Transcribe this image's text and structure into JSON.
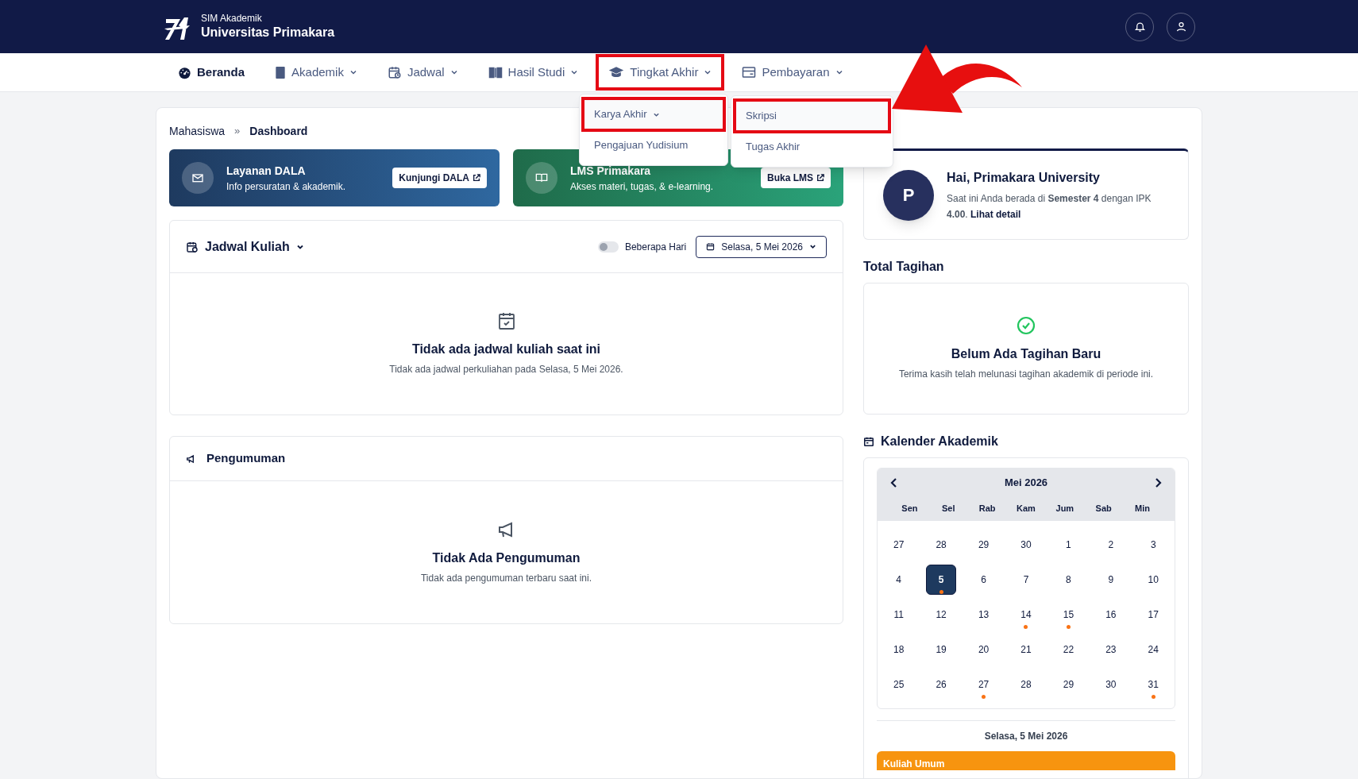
{
  "header": {
    "subtitle": "SIM Akademik",
    "title": "Universitas Primakara"
  },
  "nav": [
    {
      "label": "Beranda",
      "selected": true,
      "dropdown": false,
      "highlighted": false
    },
    {
      "label": "Akademik",
      "selected": false,
      "dropdown": true,
      "highlighted": false
    },
    {
      "label": "Jadwal",
      "selected": false,
      "dropdown": true,
      "highlighted": false
    },
    {
      "label": "Hasil Studi",
      "selected": false,
      "dropdown": true,
      "highlighted": false
    },
    {
      "label": "Tingkat Akhir",
      "selected": false,
      "dropdown": true,
      "highlighted": true
    },
    {
      "label": "Pembayaran",
      "selected": false,
      "dropdown": true,
      "highlighted": false
    }
  ],
  "menu": [
    {
      "label": "Karya Akhir",
      "submenu": true,
      "highlighted": true
    },
    {
      "label": "Pengajuan Yudisium",
      "submenu": false,
      "highlighted": false
    }
  ],
  "submenu": [
    {
      "label": "Skripsi",
      "highlighted": true
    },
    {
      "label": "Tugas Akhir",
      "highlighted": false
    }
  ],
  "breadcrumb": [
    "Mahasiswa",
    "Dashboard"
  ],
  "breadcrumb_separator": "»",
  "banners": [
    {
      "title": "Layanan DALA",
      "subtitle": "Info persuratan & akademik.",
      "button": "Kunjungi DALA"
    },
    {
      "title": "LMS Primakara",
      "subtitle": "Akses materi, tugas, & e-learning.",
      "button": "Buka LMS"
    }
  ],
  "schedule": {
    "title": "Jadwal Kuliah",
    "toggle": {
      "label": "Beberapa Hari",
      "on": false
    },
    "date": "Selasa, 5 Mei 2026",
    "empty_title": "Tidak ada jadwal kuliah saat ini",
    "empty_text": "Tidak ada jadwal perkuliahan pada Selasa, 5 Mei 2026."
  },
  "announcements": {
    "title": "Pengumuman",
    "empty_title": "Tidak Ada Pengumuman",
    "empty_text": "Tidak ada pengumuman terbaru saat ini."
  },
  "profile": {
    "initial": "P",
    "greeting": "Hai, Primakara University",
    "text": "Saat ini Anda berada di **Semester 4** dengan IPK **4.00**.",
    "link": "Lihat detail"
  },
  "billing": {
    "heading": "Total Tagihan",
    "title": "Belum Ada Tagihan Baru",
    "text": "Terima kasih telah melunasi tagihan akademik di periode ini."
  },
  "calendar": {
    "heading": "Kalender Akademik",
    "month": "Mei 2026",
    "weekdays": [
      "Sen",
      "Sel",
      "Rab",
      "Kam",
      "Jum",
      "Sab",
      "Min"
    ],
    "days": [
      {
        "day": "27",
        "selected": false,
        "event": false
      },
      {
        "day": "28",
        "selected": false,
        "event": false
      },
      {
        "day": "29",
        "selected": false,
        "event": false
      },
      {
        "day": "30",
        "selected": false,
        "event": false
      },
      {
        "day": "1",
        "selected": false,
        "event": false
      },
      {
        "day": "2",
        "selected": false,
        "event": false
      },
      {
        "day": "3",
        "selected": false,
        "event": false
      },
      {
        "day": "4",
        "selected": false,
        "event": false
      },
      {
        "day": "5",
        "selected": true,
        "event": true
      },
      {
        "day": "6",
        "selected": false,
        "event": false
      },
      {
        "day": "7",
        "selected": false,
        "event": false
      },
      {
        "day": "8",
        "selected": false,
        "event": false
      },
      {
        "day": "9",
        "selected": false,
        "event": false
      },
      {
        "day": "10",
        "selected": false,
        "event": false
      },
      {
        "day": "11",
        "selected": false,
        "event": false
      },
      {
        "day": "12",
        "selected": false,
        "event": false
      },
      {
        "day": "13",
        "selected": false,
        "event": false
      },
      {
        "day": "14",
        "selected": false,
        "event": true
      },
      {
        "day": "15",
        "selected": false,
        "event": true
      },
      {
        "day": "16",
        "selected": false,
        "event": false
      },
      {
        "day": "17",
        "selected": false,
        "event": false
      },
      {
        "day": "18",
        "selected": false,
        "event": false
      },
      {
        "day": "19",
        "selected": false,
        "event": false
      },
      {
        "day": "20",
        "selected": false,
        "event": false
      },
      {
        "day": "21",
        "selected": false,
        "event": false
      },
      {
        "day": "22",
        "selected": false,
        "event": false
      },
      {
        "day": "23",
        "selected": false,
        "event": false
      },
      {
        "day": "24",
        "selected": false,
        "event": false
      },
      {
        "day": "25",
        "selected": false,
        "event": false
      },
      {
        "day": "26",
        "selected": false,
        "event": false
      },
      {
        "day": "27",
        "selected": false,
        "event": true
      },
      {
        "day": "28",
        "selected": false,
        "event": false
      },
      {
        "day": "29",
        "selected": false,
        "event": false
      },
      {
        "day": "30",
        "selected": false,
        "event": false
      },
      {
        "day": "31",
        "selected": false,
        "event": true
      }
    ],
    "selected_date": "Selasa, 5 Mei 2026",
    "events": [
      {
        "title": "Kuliah Umum"
      }
    ]
  }
}
